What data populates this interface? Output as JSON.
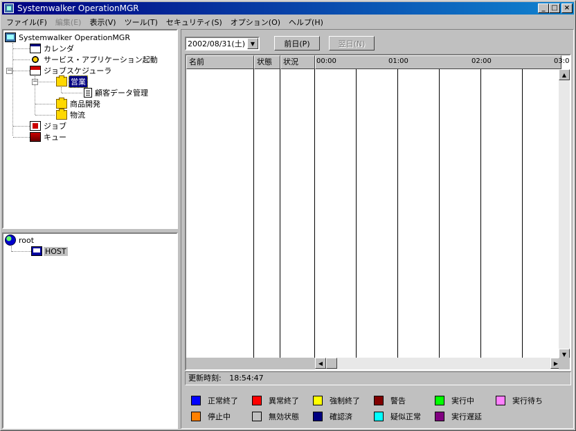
{
  "window": {
    "title": "Systemwalker OperationMGR",
    "min_label": "_",
    "max_label": "□",
    "close_label": "×"
  },
  "menu": [
    {
      "label": "ファイル(F)",
      "disabled": false
    },
    {
      "label": "編集(E)",
      "disabled": true
    },
    {
      "label": "表示(V)",
      "disabled": false
    },
    {
      "label": "ツール(T)",
      "disabled": false
    },
    {
      "label": "セキュリティ(S)",
      "disabled": false
    },
    {
      "label": "オプション(O)",
      "disabled": false
    },
    {
      "label": "ヘルプ(H)",
      "disabled": false
    }
  ],
  "tree": {
    "root": "Systemwalker OperationMGR",
    "calendar": "カレンダ",
    "service": "サービス・アプリケーション起動",
    "scheduler": "ジョブスケジューラ",
    "group_sales": "営業",
    "customer_mgmt": "顧客データ管理",
    "product_dev": "商品開発",
    "logistics": "物流",
    "job": "ジョブ",
    "queue": "キュー",
    "expander_minus": "−"
  },
  "hosts": {
    "root": "root",
    "host": "HOST"
  },
  "toolbar": {
    "date": "2002/08/31(土)",
    "dropdown_glyph": "▼",
    "prev_day": "前日(P)",
    "next_day": "翌日(N)"
  },
  "grid": {
    "columns": [
      "名前",
      "状態",
      "状況"
    ],
    "times": [
      "00:00",
      "01:00",
      "02:00",
      "03:0"
    ],
    "scroll_up": "▲",
    "scroll_down": "▼",
    "scroll_left": "◀",
    "scroll_right": "▶"
  },
  "status": {
    "label": "更新時刻:",
    "time": "18:54:47"
  },
  "legend": [
    {
      "label": "正常終了",
      "color": "#0000ff"
    },
    {
      "label": "異常終了",
      "color": "#ff0000"
    },
    {
      "label": "強制終了",
      "color": "#ffff00"
    },
    {
      "label": "警告",
      "color": "#800000"
    },
    {
      "label": "実行中",
      "color": "#00ff00"
    },
    {
      "label": "実行待ち",
      "color": "#ff80ff"
    },
    {
      "label": "停止中",
      "color": "#ff8000"
    },
    {
      "label": "無効状態",
      "color": "#c0c0c0"
    },
    {
      "label": "確認済",
      "color": "#000080"
    },
    {
      "label": "疑似正常",
      "color": "#00ffff"
    },
    {
      "label": "実行遅延",
      "color": "#800080"
    }
  ]
}
